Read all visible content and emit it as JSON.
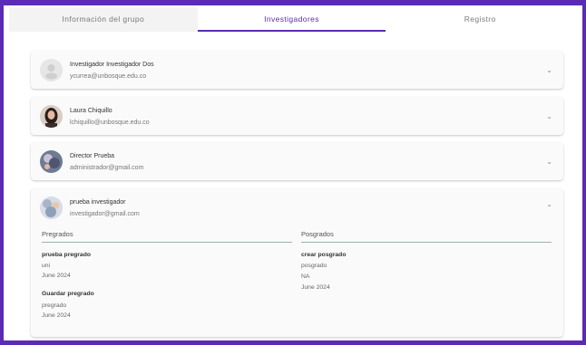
{
  "tabs": [
    {
      "label": "Información del grupo"
    },
    {
      "label": "Investigadores"
    },
    {
      "label": "Registro"
    }
  ],
  "researchers": [
    {
      "name": "Investigador Investigador Dos",
      "email": "ycurrea@unbosque.edu.co"
    },
    {
      "name": "Laura Chiquillo",
      "email": "lchiquillo@unbosque.edu.co"
    },
    {
      "name": "Director Prueba",
      "email": "administrador@gmail.com"
    },
    {
      "name": "prueba investigador",
      "email": "investigador@gmail.com"
    }
  ],
  "expanded": {
    "pregrados_header": "Pregrados",
    "posgrados_header": "Posgrados",
    "pregrados": [
      {
        "title": "prueba pregrado",
        "line1": "uni",
        "date": "June 2024"
      },
      {
        "title": "Guardar pregrado",
        "line1": "pregrado",
        "date": "June 2024"
      }
    ],
    "posgrados": [
      {
        "title": "crear posgrado",
        "line1": "posgrado",
        "line2": "NA",
        "date": "June 2024"
      }
    ]
  },
  "icons": {
    "collapsed": "chevron-down-icon",
    "expanded": "chevron-up-icon"
  },
  "colors": {
    "accent": "#5b2bb5"
  }
}
